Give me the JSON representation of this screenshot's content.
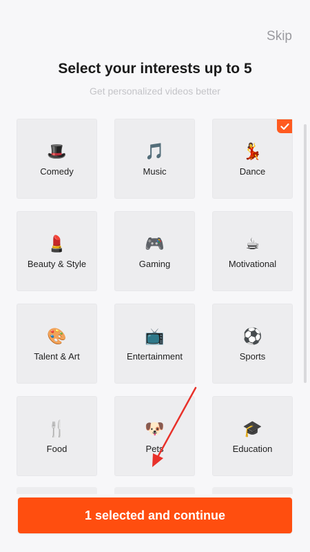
{
  "header": {
    "skip_label": "Skip",
    "title": "Select your interests up to 5",
    "subtitle": "Get personalized videos better"
  },
  "interests": [
    {
      "label": "Comedy",
      "emoji": "🎩",
      "selected": false
    },
    {
      "label": "Music",
      "emoji": "🎵",
      "selected": false
    },
    {
      "label": "Dance",
      "emoji": "💃",
      "selected": true
    },
    {
      "label": "Beauty & Style",
      "emoji": "💄",
      "selected": false
    },
    {
      "label": "Gaming",
      "emoji": "🎮",
      "selected": false
    },
    {
      "label": "Motivational",
      "emoji": "☕",
      "selected": false
    },
    {
      "label": "Talent & Art",
      "emoji": "🎨",
      "selected": false
    },
    {
      "label": "Entertainment",
      "emoji": "📺",
      "selected": false
    },
    {
      "label": "Sports",
      "emoji": "⚽",
      "selected": false
    },
    {
      "label": "Food",
      "emoji": "🍴",
      "selected": false
    },
    {
      "label": "Pets",
      "emoji": "🐶",
      "selected": false
    },
    {
      "label": "Education",
      "emoji": "🎓",
      "selected": false
    }
  ],
  "footer": {
    "continue_label": "1 selected and continue"
  },
  "colors": {
    "accent": "#ff4e0f",
    "tile_bg": "#ededef",
    "background": "#f7f7f9",
    "annotation_arrow": "#e8312a"
  }
}
